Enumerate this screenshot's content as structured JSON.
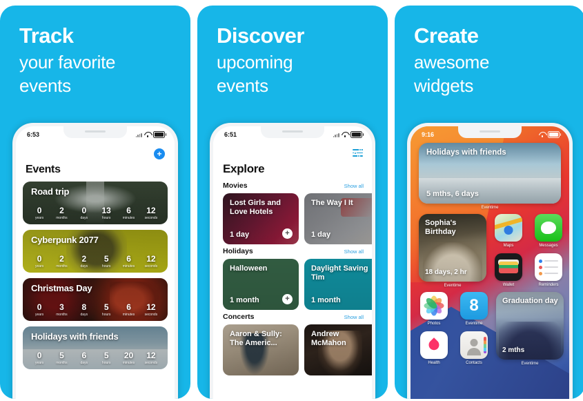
{
  "panels": [
    {
      "headline": {
        "line1": "Track",
        "line2": "your favorite",
        "line3": "events"
      },
      "phone": {
        "status": {
          "time": "6:53"
        },
        "add_label": "+",
        "title": "Events",
        "units": [
          "years",
          "months",
          "days",
          "hours",
          "minutes",
          "seconds"
        ],
        "events": [
          {
            "name": "Road trip",
            "art": "art-road",
            "values": [
              "0",
              "2",
              "0",
              "13",
              "6",
              "12"
            ]
          },
          {
            "name": "Cyberpunk 2077",
            "art": "art-cyber",
            "values": [
              "0",
              "2",
              "2",
              "5",
              "6",
              "12"
            ]
          },
          {
            "name": "Christmas Day",
            "art": "art-xmas",
            "values": [
              "0",
              "3",
              "8",
              "5",
              "6",
              "12"
            ]
          },
          {
            "name": "Holidays with friends",
            "art": "art-beach",
            "values": [
              "0",
              "5",
              "6",
              "5",
              "20",
              "12"
            ]
          }
        ]
      }
    },
    {
      "headline": {
        "line1": "Discover",
        "line2": "upcoming",
        "line3": "events"
      },
      "phone": {
        "status": {
          "time": "6:51"
        },
        "title": "Explore",
        "show_all": "Show all",
        "plus_label": "+",
        "sections": [
          {
            "title": "Movies",
            "tiles": [
              {
                "name": "Lost Girls and Love Hotels",
                "sub": "1 day",
                "art": "t-lostgirls",
                "plus": true
              },
              {
                "name": "The Way I It",
                "sub": "1 day",
                "art": "t-theway",
                "plus": false
              }
            ]
          },
          {
            "title": "Holidays",
            "tiles": [
              {
                "name": "Halloween",
                "sub": "1 month",
                "art": "t-halloween",
                "plus": true
              },
              {
                "name": "Daylight Saving Tim",
                "sub": "1 month",
                "art": "t-daylight",
                "plus": false
              }
            ]
          },
          {
            "title": "Concerts",
            "tiles": [
              {
                "name": "Aaron & Sully: The Americ...",
                "sub": "",
                "art": "t-aaron",
                "plus": false
              },
              {
                "name": "Andrew McMahon",
                "sub": "",
                "art": "t-andrew",
                "plus": false
              }
            ]
          }
        ]
      }
    },
    {
      "headline": {
        "line1": "Create",
        "line2": "awesome",
        "line3": "widgets"
      },
      "phone": {
        "status": {
          "time": "9:16"
        },
        "widget_large": {
          "name": "Holidays with friends",
          "sub": "5 mths, 6 days",
          "label": "Eventime"
        },
        "widget_birthday": {
          "name": "Sophia's Birthday",
          "sub": "18 days, 2 hr",
          "label": "Eventime"
        },
        "widget_graduation": {
          "name": "Graduation day",
          "sub": "2 mths",
          "label": "Eventime"
        },
        "apps_top": [
          {
            "label": "Maps",
            "icon": "maps-icon"
          },
          {
            "label": "Messages",
            "icon": "messages-icon"
          },
          {
            "label": "Wallet",
            "icon": "wallet-icon"
          },
          {
            "label": "Reminders",
            "icon": "reminders-icon"
          }
        ],
        "apps_bottom": [
          {
            "label": "Photos",
            "icon": "photos-icon"
          },
          {
            "label": "Eventime",
            "icon": "eventime-icon",
            "glyph": "8"
          },
          {
            "label": "Health",
            "icon": "health-icon"
          },
          {
            "label": "Contacts",
            "icon": "contacts-icon"
          }
        ]
      }
    }
  ],
  "colors": {
    "brand_blue": "#17b6e8",
    "accent_blue": "#1a8cf0",
    "link_blue": "#2a9fe0"
  }
}
